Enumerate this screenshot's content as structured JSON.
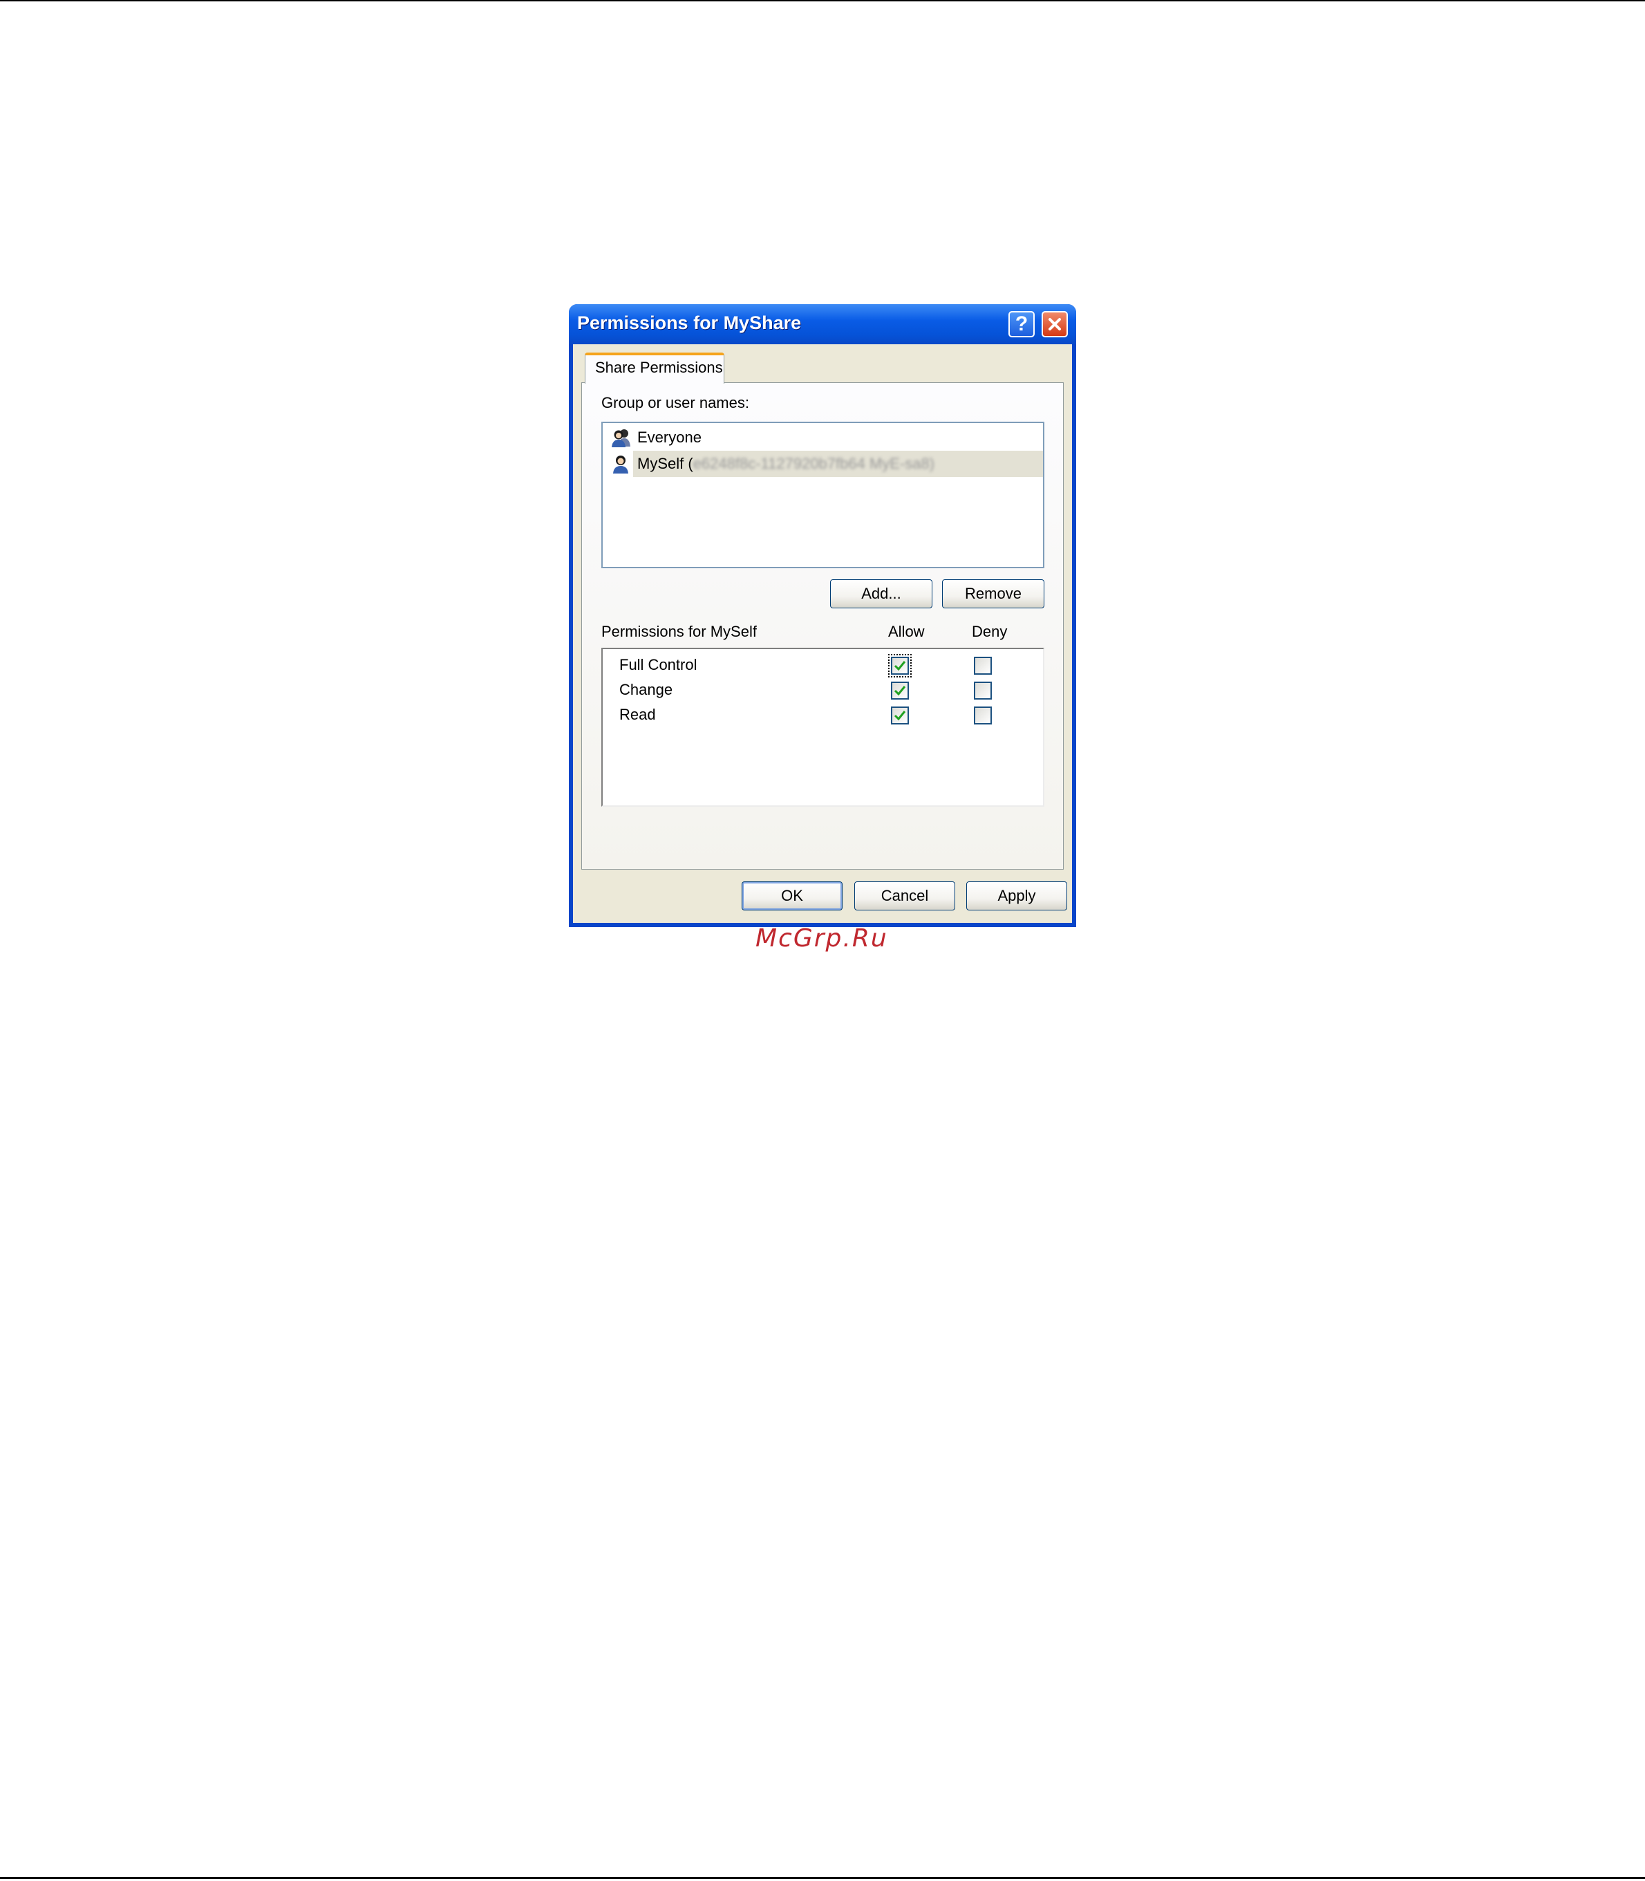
{
  "window": {
    "title": "Permissions for MyShare",
    "help_icon": "help-icon",
    "close_icon": "close-icon",
    "accent_color": "#0a5ce6",
    "close_color": "#d53a15"
  },
  "tabs": [
    {
      "label": "Share Permissions",
      "active": true
    }
  ],
  "group_list": {
    "label": "Group or user names:",
    "items": [
      {
        "name": "Everyone",
        "detail": "",
        "icon": "user-group-icon",
        "selected": false
      },
      {
        "name": "MySelf (",
        "detail": "e6248f8c-1127920b7fb64 MyE-sa8)",
        "icon": "user-icon",
        "selected": true
      }
    ]
  },
  "list_buttons": {
    "add": "Add...",
    "remove": "Remove"
  },
  "permissions": {
    "label": "Permissions for MySelf",
    "allow_header": "Allow",
    "deny_header": "Deny",
    "rows": [
      {
        "name": "Full Control",
        "allow": true,
        "deny": false,
        "focused": true
      },
      {
        "name": "Change",
        "allow": true,
        "deny": false,
        "focused": false
      },
      {
        "name": "Read",
        "allow": true,
        "deny": false,
        "focused": false
      }
    ]
  },
  "footer": {
    "ok": "OK",
    "cancel": "Cancel",
    "apply": "Apply"
  },
  "watermark": "McGrp.Ru",
  "colors": {
    "dialog_bg": "#ece9d8",
    "tab_accent": "#f5a41c",
    "check_green": "#21a121",
    "watermark": "#c0282f"
  }
}
